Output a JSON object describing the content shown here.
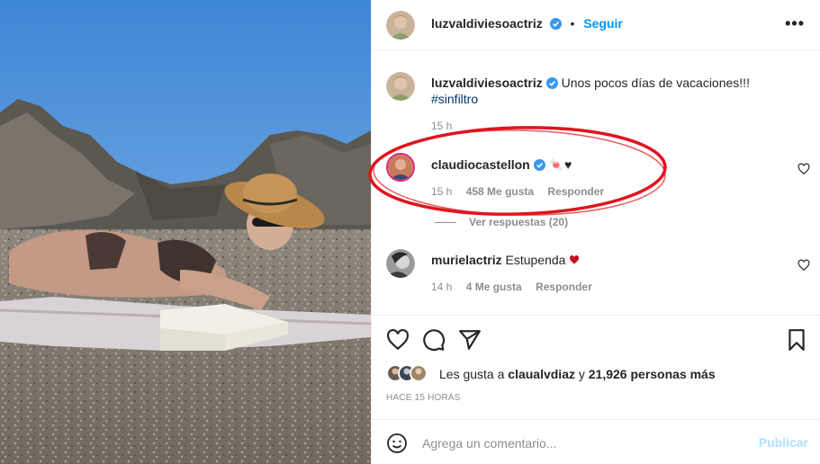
{
  "post": {
    "author": "luzvaldiviesoactriz",
    "follow_label": "Seguir",
    "separator": "•",
    "more_label": "•••"
  },
  "caption": {
    "author": "luzvaldiviesoactriz",
    "text": "Unos pocos días de vacaciones!!!",
    "hashtag": "#sinfiltro",
    "time": "15 h"
  },
  "comments": [
    {
      "author": "claudiocastellon",
      "text": "🍬♥",
      "time": "15 h",
      "likes": "458 Me gusta",
      "reply": "Responder",
      "replies_label": "Ver respuestas (20)"
    },
    {
      "author": "murielactriz",
      "text": "Estupenda ",
      "time": "14 h",
      "likes": "4 Me gusta",
      "reply": "Responder"
    }
  ],
  "likes": {
    "prefix": "Les gusta a",
    "user": "claualvdiaz",
    "joiner": "y",
    "count": "21,926 personas más"
  },
  "time_ago": "HACE 15 HORAS",
  "composer": {
    "placeholder": "Agrega un comentario...",
    "publish_label": "Publicar"
  },
  "colors": {
    "link_blue": "#0095f6",
    "verified_blue": "#3897f0",
    "annotation_red": "#e0141e",
    "heart_red": "#c1121f"
  },
  "icons": [
    "verified-badge-icon",
    "more-options-icon",
    "heart-icon",
    "comment-icon",
    "share-icon",
    "bookmark-icon",
    "emoji-icon"
  ]
}
